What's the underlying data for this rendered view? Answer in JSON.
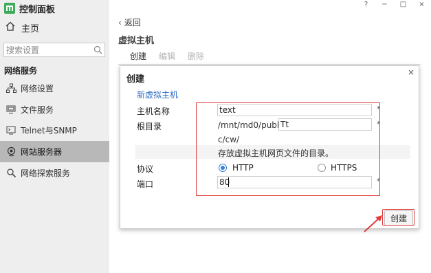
{
  "app": {
    "logo_text": "ᵐ",
    "title": "控制面板"
  },
  "sidebar": {
    "home": "主页",
    "search_placeholder": "搜索设置",
    "section": "网络服务",
    "items": [
      {
        "label": "网络设置",
        "icon": "network-icon",
        "active": false
      },
      {
        "label": "文件服务",
        "icon": "file-service-icon",
        "active": false
      },
      {
        "label": "Telnet与SNMP",
        "icon": "terminal-icon",
        "active": false
      },
      {
        "label": "网站服务器",
        "icon": "web-server-icon",
        "active": true
      },
      {
        "label": "网络探索服务",
        "icon": "discovery-icon",
        "active": false
      }
    ]
  },
  "window_controls": {
    "help": "?",
    "minimize": "−",
    "maximize": "□",
    "close": "×"
  },
  "main": {
    "back": "返回",
    "title": "虚拟主机",
    "toolbar": {
      "create": "创建",
      "edit": "编辑",
      "delete": "删除"
    }
  },
  "dialog": {
    "title": "创建",
    "close": "×",
    "link": "新虚拟主机",
    "host_label": "主机名称",
    "host_value": "text",
    "root_label": "根目录",
    "root_prefix": "/mnt/md0/publi",
    "root_value": "Tt",
    "root_suffix": "c/cw/",
    "hint": "存放虚拟主机网页文件的目录。",
    "protocol_label": "协议",
    "http": "HTTP",
    "https": "HTTPS",
    "protocol_selected": "HTTP",
    "port_label": "端口",
    "port_value": "80",
    "required_mark": "*",
    "create_button": "创建"
  },
  "colors": {
    "accent": "#3c82d6",
    "annotation": "#e23b3b",
    "logo": "#3dab5a",
    "link": "#2a6bc4"
  }
}
